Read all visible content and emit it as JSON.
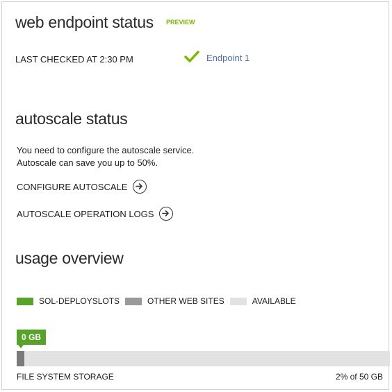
{
  "web_endpoint": {
    "title": "web endpoint status",
    "preview_badge": "PREVIEW",
    "last_checked": "LAST CHECKED AT 2:30 PM",
    "endpoint_name": "Endpoint 1",
    "endpoint_status_icon": "check-icon"
  },
  "autoscale": {
    "title": "autoscale status",
    "message_line1": "You need to configure the autoscale service.",
    "message_line2": "Autoscale can save you up to 50%.",
    "configure_label": "CONFIGURE AUTOSCALE",
    "logs_label": "AUTOSCALE OPERATION LOGS"
  },
  "usage": {
    "title": "usage overview",
    "legend": [
      {
        "label": "SOL-DEPLOYSLOTS",
        "color": "#57a329"
      },
      {
        "label": "OTHER WEB SITES",
        "color": "#9a9a9a"
      },
      {
        "label": "AVAILABLE",
        "color": "#e2e2e2"
      }
    ],
    "storage": {
      "badge": "0 GB",
      "label": "FILE SYSTEM STORAGE",
      "value_text": "2% of 50 GB",
      "used_fraction": 0.02
    }
  },
  "colors": {
    "accent_green": "#57a329",
    "preview_green": "#7ab800",
    "link_blue": "#4a6fb5"
  }
}
